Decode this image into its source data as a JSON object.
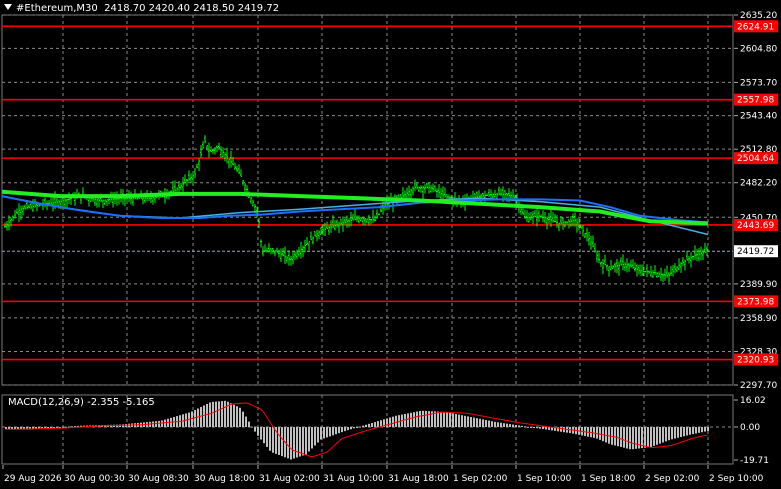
{
  "header": {
    "symbol": "#Ethereum,M30",
    "ohlc": "2418.70 2420.40 2418.50 2419.72"
  },
  "macd": {
    "label": "MACD(12,26,9) -2.355 -5.165",
    "max_label": "16.02",
    "zero_label": "0.00",
    "min_label": "-19.71"
  },
  "colors": {
    "background": "#000000",
    "grid": "#8a8a8a",
    "candles": "#00ff00",
    "ma_fast": "#1e6fff",
    "ma_mid": "#4ab0e0",
    "ma_slow": "#22ee22",
    "levels": "#ff0000",
    "macd_hist": "#c0c0c0",
    "macd_signal": "#ff0000"
  },
  "price_axis": {
    "ticks": [
      "2635.20",
      "2604.80",
      "2573.70",
      "2543.40",
      "2512.80",
      "2482.20",
      "2450.70",
      "2389.90",
      "2358.90",
      "2328.30",
      "2297.70"
    ],
    "current_price": "2419.72"
  },
  "levels": [
    "2624.91",
    "2557.98",
    "2504.64",
    "2443.69",
    "2373.98",
    "2320.93"
  ],
  "time_axis": [
    "29 Aug 2026",
    "30 Aug 00:30",
    "30 Aug 08:30",
    "30 Aug 18:00",
    "31 Aug 02:00",
    "31 Aug 10:00",
    "31 Aug 18:00",
    "1 Sep 02:00",
    "1 Sep 10:00",
    "1 Sep 18:00",
    "2 Sep 02:00",
    "2 Sep 10:00"
  ],
  "chart_data": {
    "type": "line",
    "title": "#Ethereum,M30",
    "x": [
      "29 Aug 2026",
      "30 Aug 00:30",
      "30 Aug 08:30",
      "30 Aug 18:00",
      "31 Aug 02:00",
      "31 Aug 10:00",
      "31 Aug 18:00",
      "1 Sep 02:00",
      "1 Sep 10:00",
      "1 Sep 18:00",
      "2 Sep 02:00",
      "2 Sep 10:00"
    ],
    "series": [
      {
        "values": [
          2442,
          2460,
          2470,
          2505,
          2420,
          2445,
          2475,
          2478,
          2460,
          2408,
          2400,
          2419.72
        ]
      }
    ],
    "ylim": [
      2297.7,
      2635.2
    ],
    "horizontal_levels": [
      2624.91,
      2557.98,
      2504.64,
      2443.69,
      2373.98,
      2320.93
    ]
  }
}
